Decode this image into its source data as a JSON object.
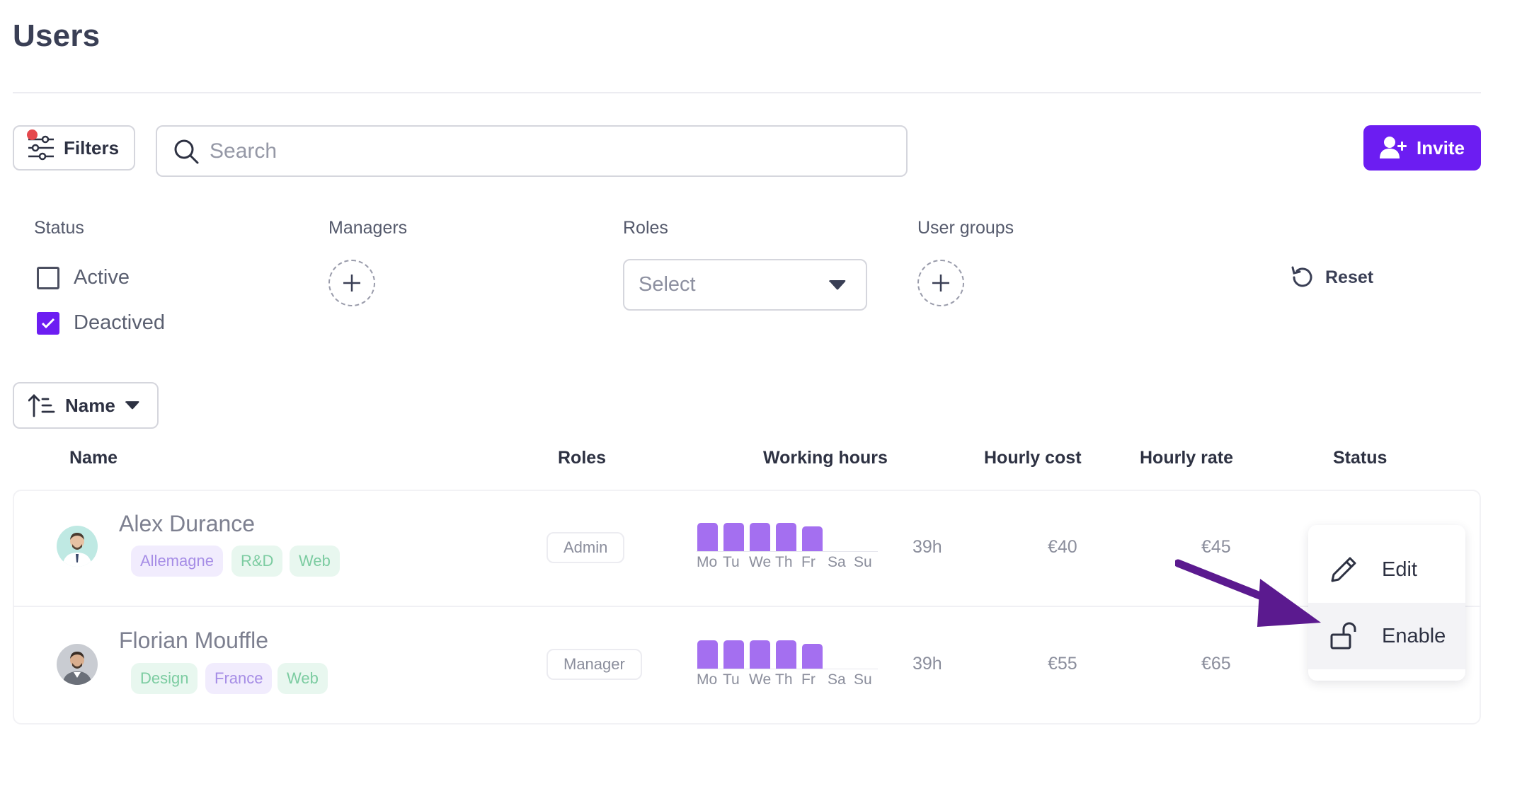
{
  "page": {
    "title": "Users"
  },
  "toolbar": {
    "filters_label": "Filters",
    "search_placeholder": "Search",
    "invite_label": "Invite"
  },
  "filters": {
    "status": {
      "label": "Status",
      "options": [
        {
          "label": "Active",
          "checked": false
        },
        {
          "label": "Deactived",
          "checked": true
        }
      ]
    },
    "managers_label": "Managers",
    "roles": {
      "label": "Roles",
      "select_placeholder": "Select"
    },
    "user_groups_label": "User groups",
    "reset_label": "Reset"
  },
  "sort": {
    "label": "Name"
  },
  "table": {
    "headers": {
      "name": "Name",
      "roles": "Roles",
      "working_hours": "Working hours",
      "hourly_cost": "Hourly cost",
      "hourly_rate": "Hourly rate",
      "status": "Status"
    },
    "days": [
      "Mo",
      "Tu",
      "We",
      "Th",
      "Fr",
      "Sa",
      "Su"
    ],
    "rows": [
      {
        "name": "Alex Durance",
        "tags": [
          {
            "label": "Allemagne",
            "color": "purple"
          },
          {
            "label": "R&D",
            "color": "green"
          },
          {
            "label": "Web",
            "color": "green"
          }
        ],
        "role": "Admin",
        "hours_per_day": [
          8,
          8,
          8,
          8,
          7,
          0,
          0
        ],
        "total_hours": "39h",
        "hourly_cost": "€40",
        "hourly_rate": "€45"
      },
      {
        "name": "Florian Mouffle",
        "tags": [
          {
            "label": "Design",
            "color": "green"
          },
          {
            "label": "France",
            "color": "purple"
          },
          {
            "label": "Web",
            "color": "green"
          }
        ],
        "role": "Manager",
        "hours_per_day": [
          8,
          8,
          8,
          8,
          7,
          0,
          0
        ],
        "total_hours": "39h",
        "hourly_cost": "€55",
        "hourly_rate": "€65"
      }
    ]
  },
  "context_menu": {
    "items": [
      {
        "label": "Edit",
        "icon": "pencil-icon"
      },
      {
        "label": "Enable",
        "icon": "unlock-icon"
      }
    ]
  },
  "colors": {
    "accent": "#6c1df2",
    "bar": "#a46ff0",
    "annotation_arrow": "#5b1a8f"
  }
}
